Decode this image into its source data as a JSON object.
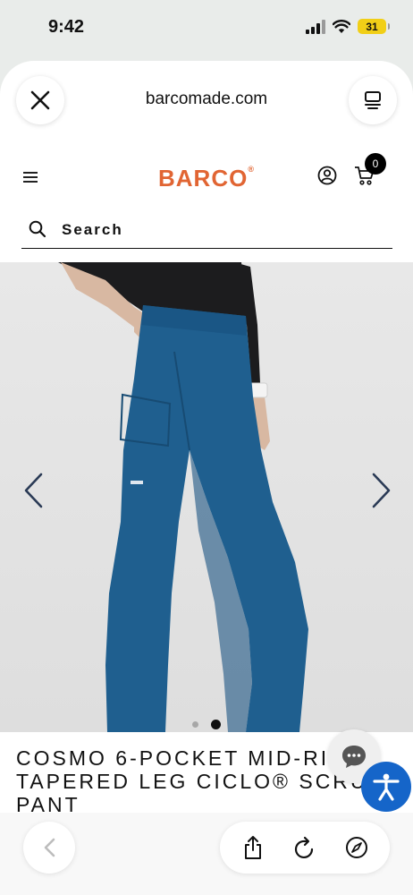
{
  "status_bar": {
    "time": "9:42",
    "battery": "31"
  },
  "browser": {
    "url": "barcomade.com"
  },
  "site": {
    "brand": "BARCO",
    "brand_mark": "®",
    "brand_color": "#E16533",
    "cart_count": "0",
    "search_label": "Search"
  },
  "product": {
    "image_count": 2,
    "active_image": 2,
    "pant_color": "#1E5E8E",
    "title": "COSMO 6-POCKET MID-RISE TAPERED LEG CICLO® SCRUB PANT"
  },
  "icons": {
    "close": "close-icon",
    "reader": "reader-view-icon",
    "menu": "hamburger-menu-icon",
    "account": "account-icon",
    "cart": "cart-icon",
    "search": "search-icon",
    "prev": "chevron-left-icon",
    "next": "chevron-right-icon",
    "chat": "chat-icon",
    "accessibility": "accessibility-icon",
    "back": "back-icon",
    "share": "share-icon",
    "reload": "reload-icon",
    "compass": "compass-icon"
  },
  "colors": {
    "accessibility_button": "#1565C9",
    "chrome_background": "#E9ECEA"
  }
}
